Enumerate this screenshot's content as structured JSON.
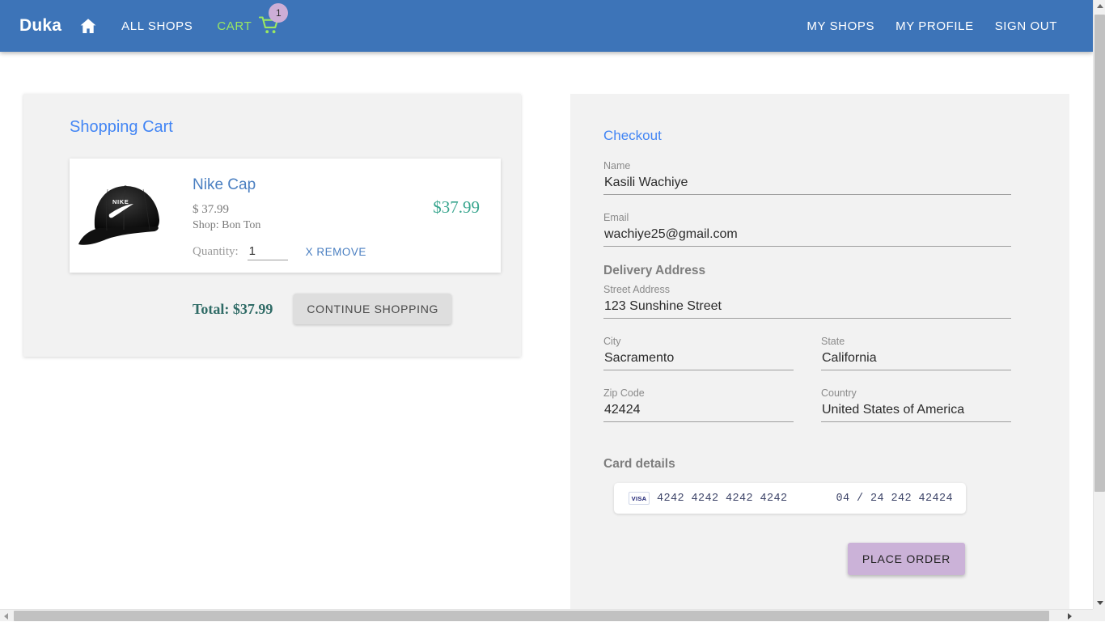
{
  "navbar": {
    "brand": "Duka",
    "home_icon": "home-icon",
    "all_shops": "ALL SHOPS",
    "cart": "CART",
    "cart_icon": "shopping-cart-icon",
    "cart_count": "1",
    "my_shops": "MY SHOPS",
    "my_profile": "MY PROFILE",
    "sign_out": "SIGN OUT",
    "bg_color": "#3d74b8",
    "cart_link_color": "#9ae861",
    "badge_color": "#cdaed6"
  },
  "cart": {
    "title": "Shopping Cart",
    "items": [
      {
        "name": "Nike Cap",
        "unit_price": "$ 37.99",
        "shop": "Shop: Bon Ton",
        "quantity_label": "Quantity:",
        "quantity": "1",
        "remove_label": "X REMOVE",
        "line_total": "$37.99",
        "thumb_icon": "nike-cap-product-image"
      }
    ],
    "total": "Total: $37.99",
    "continue_shopping": "CONTINUE SHOPPING",
    "title_color": "#4285f4",
    "total_color": "#2f6b66",
    "price_color": "#3aa68f"
  },
  "checkout": {
    "title": "Checkout",
    "name": {
      "label": "Name",
      "value": "Kasili Wachiye"
    },
    "email": {
      "label": "Email",
      "value": "wachiye25@gmail.com"
    },
    "delivery_heading": "Delivery Address",
    "street": {
      "label": "Street Address",
      "value": "123 Sunshine Street"
    },
    "city": {
      "label": "City",
      "value": "Sacramento"
    },
    "state": {
      "label": "State",
      "value": "California"
    },
    "zip": {
      "label": "Zip Code",
      "value": "42424"
    },
    "country": {
      "label": "Country",
      "value": "United States of America"
    },
    "card_heading": "Card details",
    "card": {
      "brand_mark": "VISA",
      "number": "4242 4242 4242 4242",
      "extra": "04 / 24 242  42424"
    },
    "place_order": "PLACE ORDER",
    "title_color": "#4285f4",
    "place_order_color": "#cbb2d8"
  },
  "scrollbars": {
    "vertical_up": "scroll-up-arrow-icon",
    "vertical_down": "scroll-down-arrow-icon",
    "horizontal_left": "scroll-left-arrow-icon",
    "horizontal_right": "scroll-right-arrow-icon"
  }
}
